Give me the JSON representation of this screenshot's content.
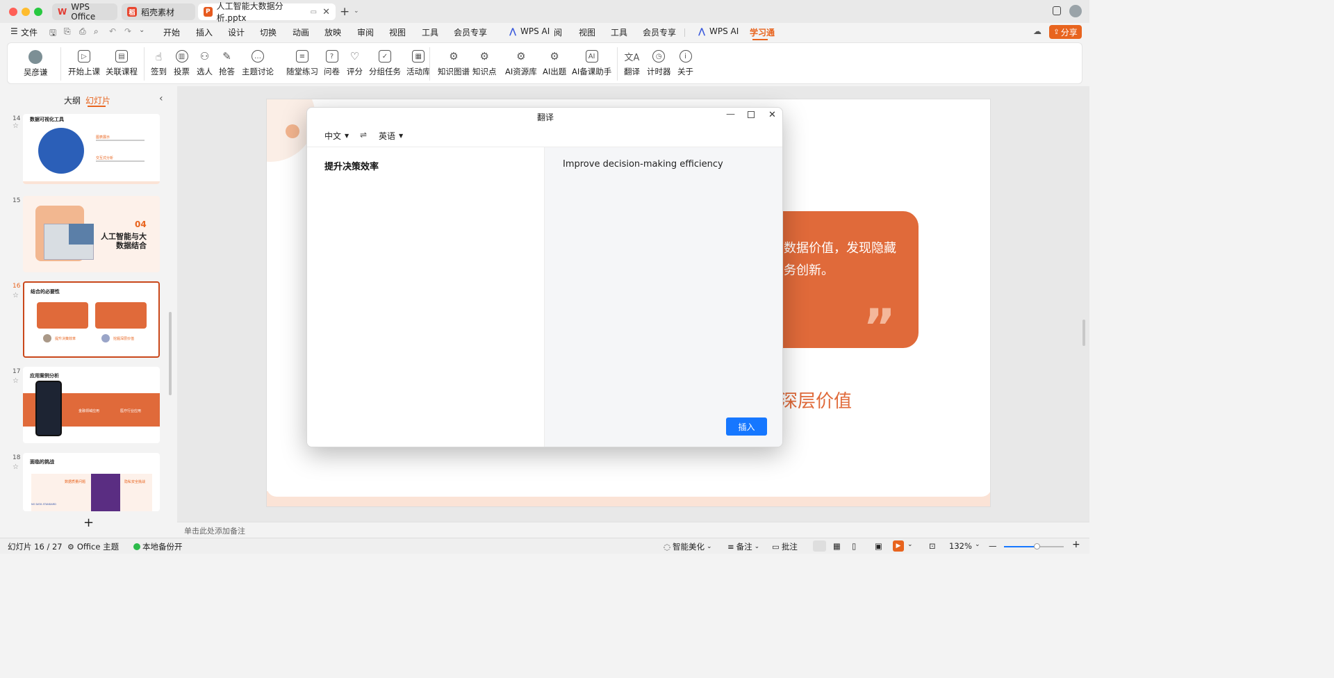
{
  "window": {
    "tabs": [
      {
        "label": "WPS Office",
        "icon": "wps-logo-icon",
        "color": "#e23b32"
      },
      {
        "label": "稻壳素材",
        "icon": "docer-logo-icon",
        "color": "#e8462f"
      },
      {
        "label": "人工智能大数据分析.pptx",
        "icon": "ppt-file-icon",
        "color": "#e65a1f"
      }
    ]
  },
  "menu": {
    "file": "文件",
    "items": [
      "开始",
      "插入",
      "设计",
      "切换",
      "动画",
      "放映",
      "审阅",
      "视图",
      "工具",
      "会员专享"
    ],
    "wps_ai": "WPS AI",
    "items2": [
      "阅",
      "视图",
      "工具",
      "会员专享"
    ],
    "wps_ai2": "WPS AI",
    "active": "学习通",
    "share": "分享",
    "accent": "#e8641e"
  },
  "ribbon": {
    "user": "吴彦谦",
    "buttons": [
      "开始上课",
      "关联课程",
      "签到",
      "投票",
      "选人",
      "抢答",
      "主题讨论",
      "随堂练习",
      "问卷",
      "评分",
      "分组任务",
      "活动库",
      "知识图谱",
      "知识点",
      "AI资源库",
      "AI出题",
      "AI备课助手",
      "翻译",
      "计时器",
      "关于"
    ]
  },
  "leftpanel": {
    "tab_outline": "大纲",
    "tab_slides": "幻灯片",
    "slides": [
      {
        "num": "14",
        "title": "数据可视化工具",
        "b1": "图表展示",
        "b2": "交互式分析"
      },
      {
        "num": "15",
        "num_text": "04",
        "title": "人工智能与大数据结合"
      },
      {
        "num": "16",
        "title": "结合的必要性",
        "label1": "提升决策效率",
        "label2": "挖掘深层价值"
      },
      {
        "num": "17",
        "title": "应用案例分析",
        "item1": "金融领域应用",
        "item2": "医疗行业应用"
      },
      {
        "num": "18",
        "title": "面临的挑战",
        "item1": "数据质量问题",
        "item2": "隐私安全挑战",
        "caption": "NO DATA STANDARD"
      }
    ],
    "add": "+"
  },
  "slide_canvas": {
    "card_text_line1": "数据价值，发现隐藏",
    "card_text_line2": "务创新。",
    "quote": "”",
    "heading_partial": "深层价值"
  },
  "dialog": {
    "title": "翻译",
    "source_lang": "中文",
    "target_lang": "英语",
    "swap": "⇌",
    "source_text": "提升决策效率",
    "translated_text": "Improve decision-making efficiency",
    "insert": "插入",
    "insert_color": "#1677ff"
  },
  "notes_placeholder": "单击此处添加备注",
  "status": {
    "slide_indicator": "幻灯片 16 / 27",
    "theme": "Office 主题",
    "backup": "本地备份开",
    "beautify": "智能美化",
    "notes": "备注",
    "comments": "批注",
    "zoom": "132%"
  }
}
